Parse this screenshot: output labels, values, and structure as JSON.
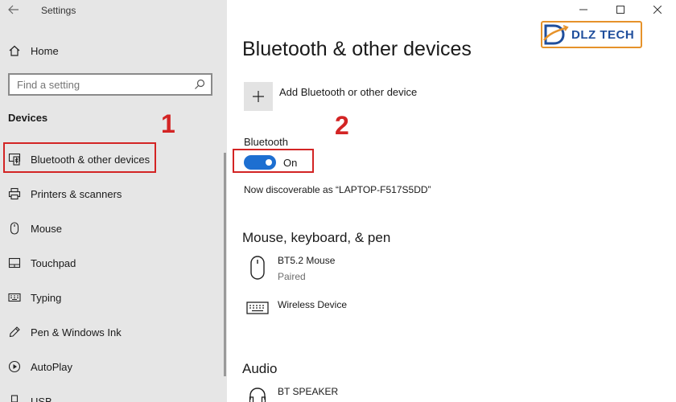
{
  "window": {
    "title": "Settings",
    "back_icon": "arrow-left-icon",
    "controls": [
      "minimize-icon",
      "maximize-icon",
      "close-icon"
    ]
  },
  "sidebar": {
    "home_label": "Home",
    "search_placeholder": "Find a setting",
    "section_heading": "Devices",
    "items": [
      {
        "label": "Bluetooth & other devices",
        "icon": "bluetooth-devices-icon",
        "selected": true
      },
      {
        "label": "Printers & scanners",
        "icon": "printer-icon"
      },
      {
        "label": "Mouse",
        "icon": "mouse-icon"
      },
      {
        "label": "Touchpad",
        "icon": "touchpad-icon"
      },
      {
        "label": "Typing",
        "icon": "keyboard-icon"
      },
      {
        "label": "Pen & Windows Ink",
        "icon": "pen-icon"
      },
      {
        "label": "AutoPlay",
        "icon": "autoplay-icon"
      },
      {
        "label": "USB",
        "icon": "usb-icon"
      }
    ]
  },
  "main": {
    "title": "Bluetooth & other devices",
    "add_device_label": "Add Bluetooth or other device",
    "bluetooth_label": "Bluetooth",
    "bluetooth_state": "On",
    "discoverable_text": "Now discoverable as “LAPTOP-F517S5DD”",
    "sections": [
      {
        "heading": "Mouse, keyboard, & pen",
        "devices": [
          {
            "name": "BT5.2 Mouse",
            "status": "Paired",
            "icon": "mouse-icon"
          },
          {
            "name": "Wireless Device",
            "status": "",
            "icon": "keyboard-icon"
          }
        ]
      },
      {
        "heading": "Audio",
        "devices": [
          {
            "name": "BT SPEAKER",
            "status": "",
            "icon": "headphones-icon"
          }
        ]
      }
    ]
  },
  "annotations": {
    "marker_1": "1",
    "marker_2": "2",
    "color": "#d32424"
  },
  "watermark": {
    "text": "DLZ TECH",
    "color": "#1f4e9c",
    "border_color": "#e6922a"
  },
  "colors": {
    "accent": "#1d6fd1",
    "sidebar_bg": "#e6e6e6"
  }
}
